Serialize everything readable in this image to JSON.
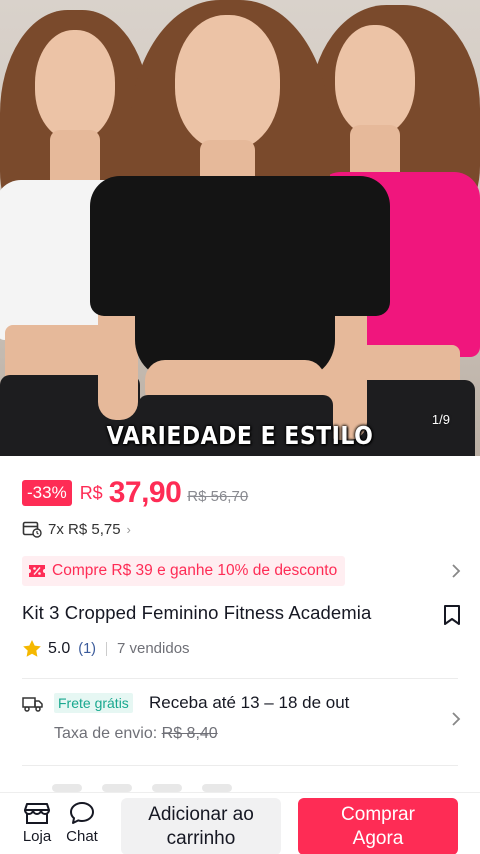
{
  "gallery": {
    "caption": "VARIEDADE E ESTILO",
    "counter": "1/9",
    "colors": {
      "white_shirt": "#f4f4f4",
      "black_shirt": "#141414",
      "pink_shirt": "#f0167d"
    }
  },
  "price": {
    "discount_badge": "-33%",
    "currency": "R$",
    "current": "37,90",
    "original": "R$ 56,70",
    "installments": "7x R$ 5,75",
    "installments_chevron": "›"
  },
  "promo": {
    "text": "Compre R$ 39 e ganhe 10% de desconto"
  },
  "product": {
    "title": "Kit 3 Cropped Feminino Fitness Academia",
    "rating": "5.0",
    "rating_count": "(1)",
    "sold": "7 vendidos"
  },
  "shipping": {
    "free_badge": "Frete grátis",
    "delivery": "Receba até 13 – 18 de out",
    "fee_label": "Taxa de envio:",
    "fee_old": "R$ 8,40"
  },
  "actions": {
    "store_label": "Loja",
    "chat_label": "Chat",
    "add_cart_line1": "Adicionar ao",
    "add_cart_line2": "carrinho",
    "buy_line1": "Comprar",
    "buy_line2": "Agora"
  },
  "theme": {
    "accent": "#fe2c55",
    "free_shipping": "#19a88f"
  }
}
